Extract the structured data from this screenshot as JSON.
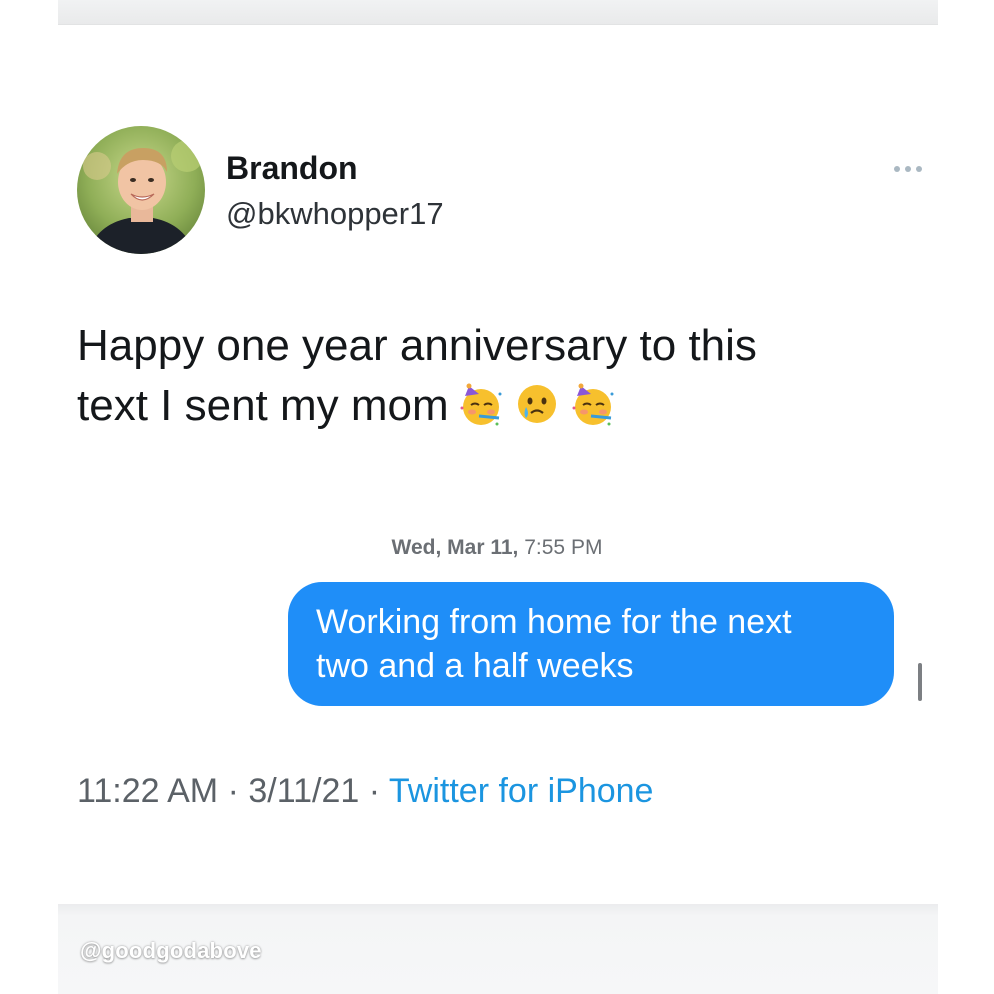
{
  "tweet": {
    "author": {
      "display_name": "Brandon",
      "handle": "@bkwhopper17"
    },
    "text_line1": "Happy one year anniversary to this",
    "text_line2": "text I sent my mom",
    "emojis": [
      "partying-face-emoji",
      "crying-face-emoji",
      "partying-face-emoji"
    ],
    "footer": {
      "time": "11:22 AM",
      "separator": " · ",
      "date": "3/11/21",
      "source": "Twitter for iPhone"
    }
  },
  "message_screenshot": {
    "timestamp_day": "Wed, Mar 11,",
    "timestamp_time": "7:55 PM",
    "bubble_line1": "Working from home for the next",
    "bubble_line2": "two and a half weeks"
  },
  "watermark": "@goodgodabove",
  "colors": {
    "bubble_blue": "#1f8ef8",
    "link_blue": "#1b95e0",
    "text_dark": "#14171a"
  }
}
